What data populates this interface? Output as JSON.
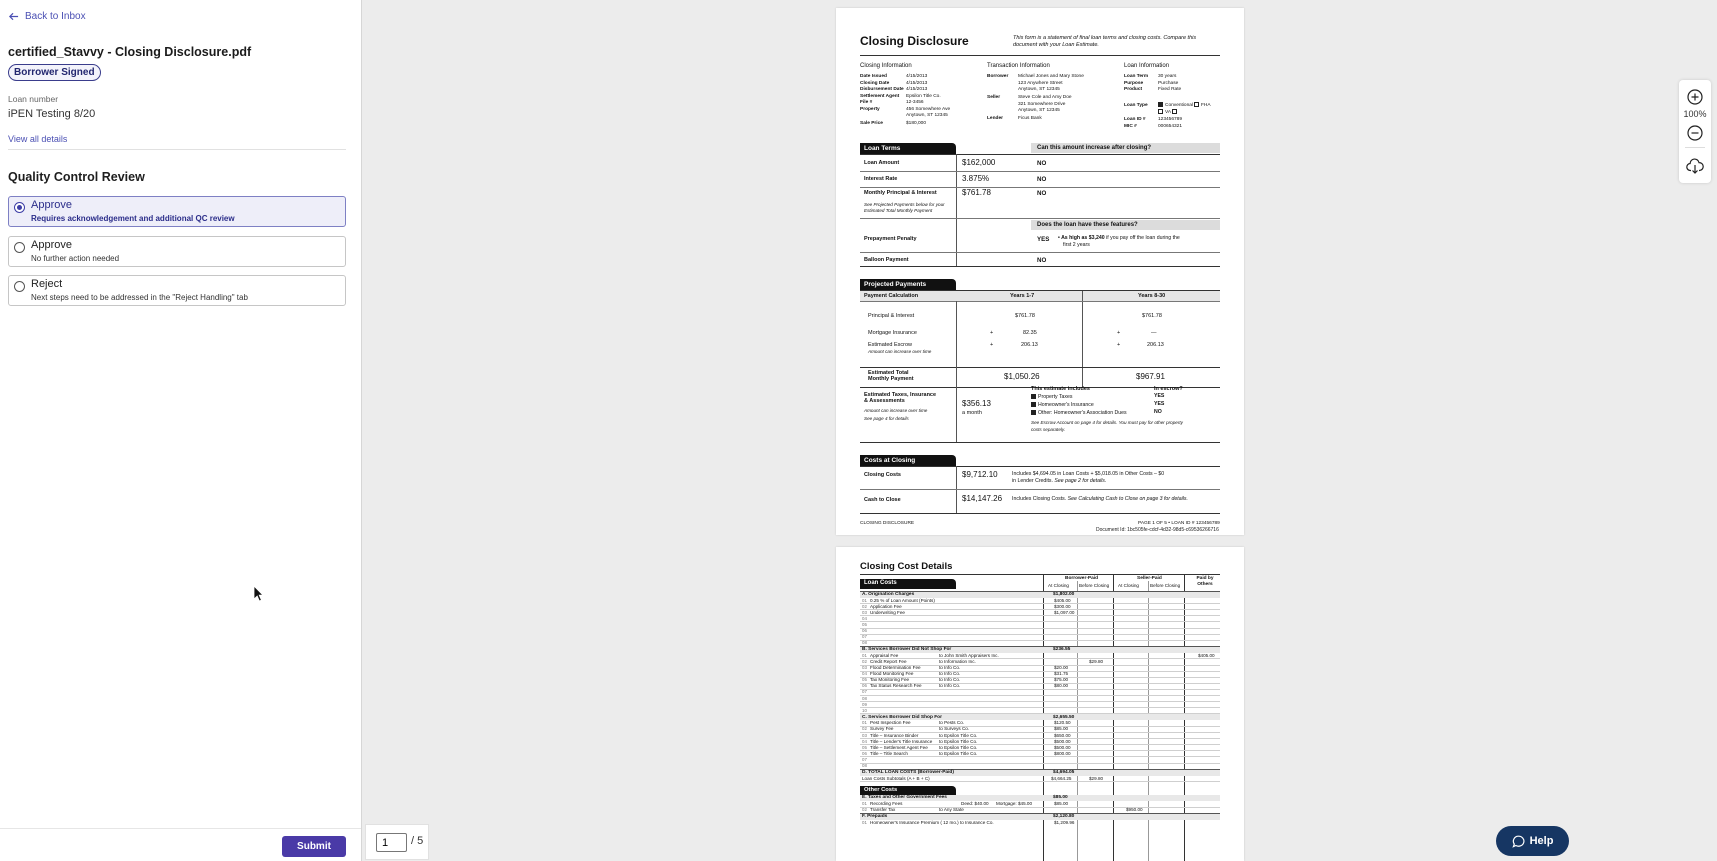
{
  "left_panel": {
    "back_label": "Back to Inbox",
    "document_title": "certified_Stavvy - Closing Disclosure.pdf",
    "status_badge": "Borrower Signed",
    "loan_number_label": "Loan number",
    "loan_number_value": "iPEN Testing 8/20",
    "view_all_label": "View all details",
    "qc_title": "Quality Control Review",
    "options": [
      {
        "title": "Approve",
        "subtitle": "Requires acknowledgement and additional QC review",
        "selected": true
      },
      {
        "title": "Approve",
        "subtitle": "No further action needed",
        "selected": false
      },
      {
        "title": "Reject",
        "subtitle": "Next steps need to be addressed in the \"Reject Handling\" tab",
        "selected": false
      }
    ],
    "submit_label": "Submit"
  },
  "viewer": {
    "current_page": "1",
    "total_pages": "/ 5",
    "zoom_level": "100%",
    "help_label": "Help"
  },
  "page1": {
    "title": "Closing Disclosure",
    "intro": "This form is a statement of final loan terms and closing costs. Compare this document with your Loan Estimate.",
    "closing_info_head": "Closing  Information",
    "transaction_info_head": "Transaction  Information",
    "loan_info_head": "Loan  Information",
    "closing_rows": [
      {
        "label": "Date Issued",
        "value": "4/15/2013"
      },
      {
        "label": "Closing Date",
        "value": "4/15/2013"
      },
      {
        "label": "Disbursement Date",
        "value": "4/15/2013"
      },
      {
        "label": "Settlement Agent",
        "value": "Epsilon Title Co."
      },
      {
        "label": "File #",
        "value": "12-3456"
      },
      {
        "label": "Property",
        "value": "456 Somewhere Ave"
      },
      {
        "label": "",
        "value": "Anytown, ST 12345"
      },
      {
        "label": "Sale Price",
        "value": "$180,000"
      }
    ],
    "transaction_rows": [
      {
        "label": "Borrower",
        "value": "Michael Jones and Mary Stone"
      },
      {
        "label": "",
        "value": "123 Anywhere Street"
      },
      {
        "label": "",
        "value": "Anytown, ST 12345"
      },
      {
        "label": "Seller",
        "value": "Steve Cole and Amy Doe"
      },
      {
        "label": "",
        "value": "321 Somewhere Drive"
      },
      {
        "label": "",
        "value": "Anytown, ST 12345"
      },
      {
        "label": "Lender",
        "value": "Ficus Bank"
      }
    ],
    "loan_rows": [
      {
        "label": "Loan Term",
        "value": "30 years"
      },
      {
        "label": "Purpose",
        "value": "Purchase"
      },
      {
        "label": "Product",
        "value": "Fixed Rate"
      }
    ],
    "loan_type_label": "Loan Type",
    "loan_type_conventional": "Conventional",
    "loan_type_fha": "FHA",
    "loan_type_va": "VA",
    "loan_id_label": "Loan ID #",
    "loan_id_value": "123456789",
    "mic_label": "MIC #",
    "mic_value": "000654321",
    "loan_terms_tab": "Loan Terms",
    "increase_question": "Can this amount increase after closing?",
    "terms": [
      {
        "label": "Loan Amount",
        "value": "$162,000",
        "answer": "NO"
      },
      {
        "label": "Interest Rate",
        "value": "3.875%",
        "answer": "NO"
      },
      {
        "label": "Monthly Principal & Interest",
        "value": "$761.78",
        "answer": "NO"
      }
    ],
    "mpi_note": "See Projected Payments below for your Estimated Total Monthly Payment",
    "features_question": "Does the loan have these features?",
    "prepay_label": "Prepayment Penalty",
    "prepay_answer": "YES",
    "prepay_detail_bold": "• As high as $3,240",
    "prepay_detail": "if you pay off the loan during the",
    "prepay_detail2": "first 2 years",
    "balloon_label": "Balloon Payment",
    "balloon_answer": "NO",
    "projected_tab": "Projected Payments",
    "payment_calc": "Payment Calculation",
    "years_a": "Years 1-7",
    "years_b": "Years 8-30",
    "pi_label": "Principal & Interest",
    "pi_a": "$761.78",
    "pi_b": "$761.78",
    "mi_label": "Mortgage Insurance",
    "mi_a": "82.35",
    "mi_b": "—",
    "esc_label": "Estimated Escrow",
    "esc_note": "Amount can increase over time",
    "esc_a": "206.13",
    "esc_b": "206.13",
    "plus": "+",
    "total_label_1": "Estimated Total",
    "total_label_2": "Monthly Payment",
    "total_a": "$1,050.26",
    "total_b": "$967.91",
    "taxes_label_1": "Estimated Taxes, Insurance",
    "taxes_label_2": "& Assessments",
    "taxes_note_1": "Amount can increase over time",
    "taxes_note_2": "See page 4 for details",
    "taxes_amount": "$356.13",
    "taxes_period": "a month",
    "includes_head": "This estimate includes",
    "escrow_head": "In escrow?",
    "includes": [
      {
        "label": "Property Taxes",
        "answer": "YES"
      },
      {
        "label": "Homeowner's Insurance",
        "answer": "YES"
      },
      {
        "label": "Other: Homeowner's Association Dues",
        "answer": "NO"
      }
    ],
    "escrow_note_1": "See Escrow Account on page 4 for details. You must pay for other property",
    "escrow_note_2": "costs separately.",
    "costs_tab": "Costs at Closing",
    "closing_costs_label": "Closing Costs",
    "closing_costs_value": "$9,712.10",
    "closing_costs_detail_1": "Includes $4,694.05 in Loan Costs + $5,018.05 in Other Costs – $0",
    "closing_costs_detail_2": "in Lender Credits.",
    "closing_costs_detail_3": "See page 2 for details.",
    "cash_label": "Cash to Close",
    "cash_value": "$14,147.26",
    "cash_detail": "Includes Closing Costs.",
    "cash_detail_i": "See Calculating Cash to Close on page 3 for details.",
    "footer_left": "CLOSING DISCLOSURE",
    "footer_right": "PAGE 1 OF 5 • LOAN ID # 123456789",
    "document_id": "Document Id: 1bc505fe-cdcf-4d32-98d5-c69536266716"
  },
  "page2": {
    "title": "Closing Cost Details",
    "loan_costs_tab": "Loan Costs",
    "borrower_paid": "Borrower-Paid",
    "seller_paid": "Seller-Paid",
    "paid_by_others": "Paid by Others",
    "at_closing": "At Closing",
    "before_closing": "Before Closing",
    "sec_a": "A. Origination Charges",
    "sec_a_total": "$1,802.00",
    "a_rows": [
      {
        "n": "01",
        "label": "0.25  % of Loan Amount (Points)",
        "to": "",
        "amount": "$405.00"
      },
      {
        "n": "02",
        "label": "Application Fee",
        "to": "",
        "amount": "$300.00"
      },
      {
        "n": "03",
        "label": "Underwriting Fee",
        "to": "",
        "amount": "$1,097.00"
      }
    ],
    "sec_b": "B. Services Borrower Did Not Shop For",
    "sec_b_total": "$236.55",
    "b_rows": [
      {
        "n": "01",
        "label": "Appraisal Fee",
        "to": "to  John Smith Appraisers Inc.",
        "amount": ""
      },
      {
        "n": "02",
        "label": "Credit Report Fee",
        "to": "to  Information Inc.",
        "amount": ""
      },
      {
        "n": "03",
        "label": "Flood Determination Fee",
        "to": "to  Info Co.",
        "amount": "$20.00"
      },
      {
        "n": "04",
        "label": "Flood Monitoring Fee",
        "to": "to  Info Co.",
        "amount": "$31.75"
      },
      {
        "n": "05",
        "label": "Tax Monitoring Fee",
        "to": "to  Info Co.",
        "amount": "$75.00"
      },
      {
        "n": "06",
        "label": "Tax Status Research Fee",
        "to": "to  Info Co.",
        "amount": "$80.00"
      }
    ],
    "b_before_closing": "$29.80",
    "b_others": "$405.00",
    "sec_c": "C. Services Borrower Did Shop For",
    "sec_c_total": "$2,655.50",
    "c_rows": [
      {
        "n": "01",
        "label": "Pest Inspection Fee",
        "to": "to  Pests Co.",
        "amount": "$120.50"
      },
      {
        "n": "02",
        "label": "Survey Fee",
        "to": "to  Surveys Co.",
        "amount": "$85.00"
      },
      {
        "n": "03",
        "label": "Title – Insurance Binder",
        "to": "to  Epsilon Title Co.",
        "amount": "$650.00"
      },
      {
        "n": "04",
        "label": "Title – Lender's Title Insurance",
        "to": "to  Epsilon Title Co.",
        "amount": "$500.00"
      },
      {
        "n": "05",
        "label": "Title – Settlement Agent Fee",
        "to": "to  Epsilon Title Co.",
        "amount": "$500.00"
      },
      {
        "n": "06",
        "label": "Title – Title Search",
        "to": "to  Epsilon Title Co.",
        "amount": "$800.00"
      }
    ],
    "sec_d": "D. TOTAL LOAN COSTS (Borrower-Paid)",
    "sec_d_total": "$4,694.05",
    "subtotals_label": "Loan Costs Subtotals (A + B + C)",
    "subtotals_at": "$4,664.25",
    "subtotals_before": "$29.80",
    "other_costs_tab": "Other Costs",
    "sec_e": "E. Taxes and Other Government Fees",
    "sec_e_total": "$85.00",
    "e1_label": "Recording Fees",
    "e1_deed": "Deed: $40.00",
    "e1_mort": "Mortgage: $45.00",
    "e1_amount": "$85.00",
    "e2_label": "Transfer Tax",
    "e2_to": "to  Any State",
    "e2_seller": "$950.00",
    "sec_f": "F. Prepaids",
    "sec_f_total": "$2,120.80",
    "f1_label": "Homeowner's Insurance Premium ( 12  mo.)  to Insurance Co.",
    "f1_amount": "$1,209.96"
  }
}
